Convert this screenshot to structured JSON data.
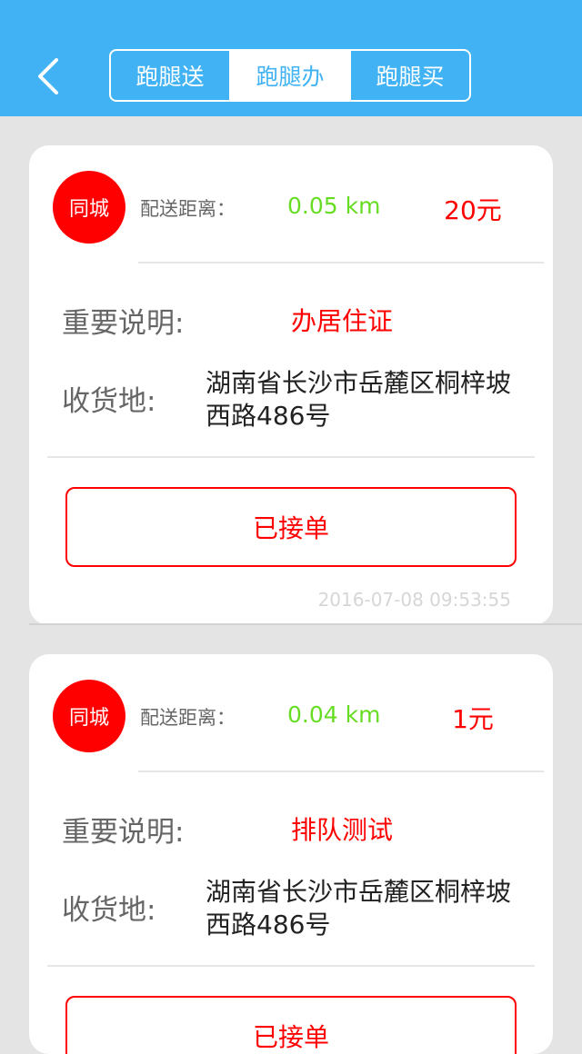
{
  "header": {
    "back_icon": "chevron-left-icon",
    "tabs": [
      {
        "label": "跑腿送",
        "active": false
      },
      {
        "label": "跑腿办",
        "active": true
      },
      {
        "label": "跑腿买",
        "active": false
      }
    ]
  },
  "colors": {
    "header_bg": "#41b3f5",
    "accent_red": "#ff0000",
    "distance_green": "#66dd22",
    "page_bg": "#e4e4e4"
  },
  "orders": [
    {
      "badge": "同城",
      "distance_label": "配送距离：",
      "distance_value": "0.05 km",
      "price": "20元",
      "note_label": "重要说明:",
      "note_value": "办居住证",
      "address_label": "收货地:",
      "address_value": "湖南省长沙市岳麓区桐梓坡西路486号",
      "status_button": "已接单",
      "timestamp": "2016-07-08 09:53:55"
    },
    {
      "badge": "同城",
      "distance_label": "配送距离：",
      "distance_value": "0.04 km",
      "price": "1元",
      "note_label": "重要说明:",
      "note_value": "排队测试",
      "address_label": "收货地:",
      "address_value": "湖南省长沙市岳麓区桐梓坡西路486号",
      "status_button": "已接单"
    }
  ]
}
